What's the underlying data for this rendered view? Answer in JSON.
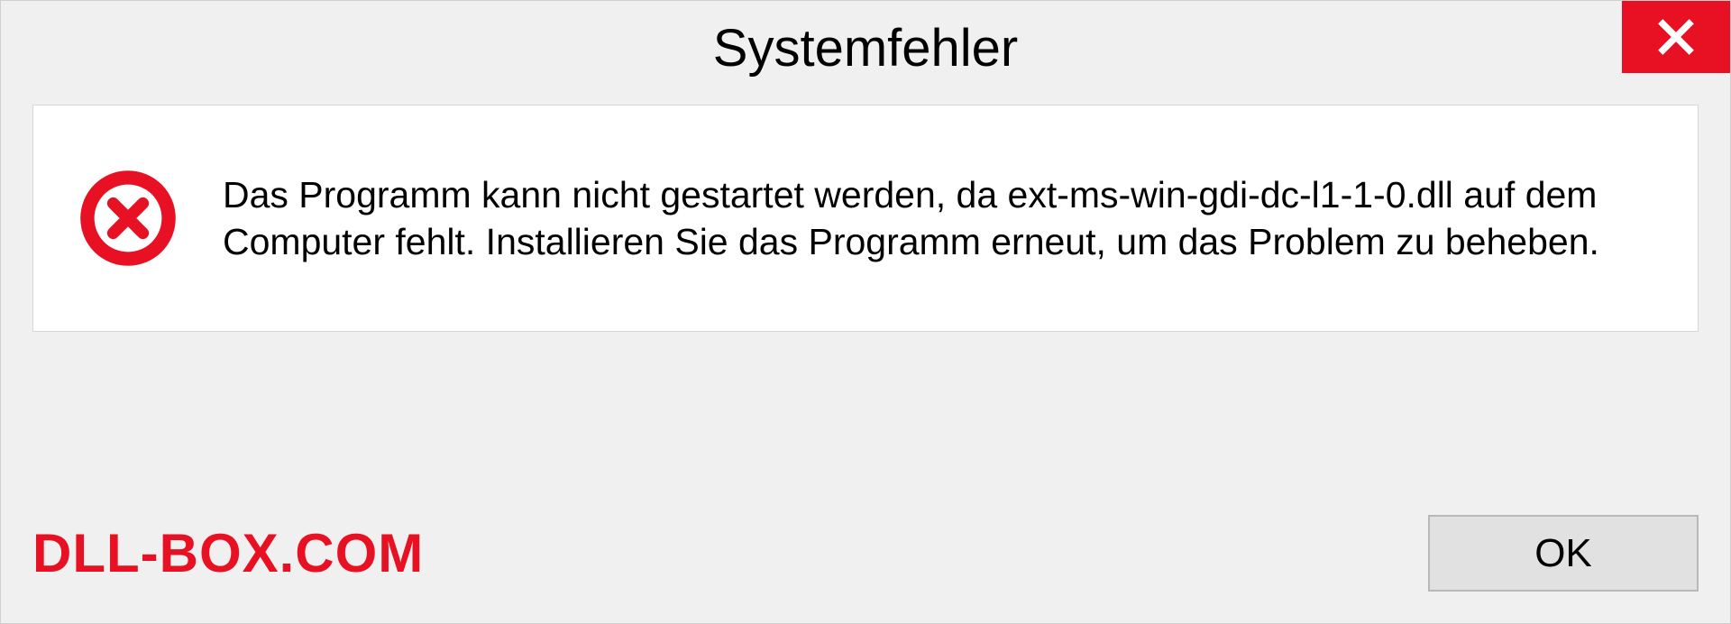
{
  "dialog": {
    "title": "Systemfehler",
    "message": "Das Programm kann nicht gestartet werden, da ext-ms-win-gdi-dc-l1-1-0.dll auf dem Computer fehlt. Installieren Sie das Programm erneut, um das Problem zu beheben.",
    "ok_label": "OK"
  },
  "watermark": "DLL-BOX.COM"
}
